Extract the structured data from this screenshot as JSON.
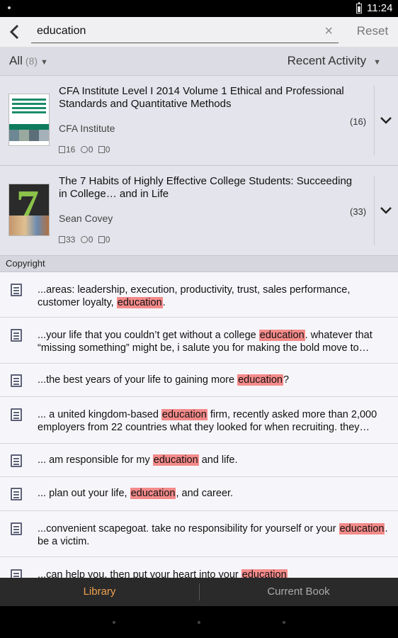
{
  "status_bar": {
    "time": "11:24"
  },
  "search": {
    "query": "education",
    "clear_icon": "×",
    "reset_label": "Reset"
  },
  "filter": {
    "label": "All",
    "count": "(8)",
    "sort_label": "Recent Activity"
  },
  "books": [
    {
      "title": "CFA Institute Level I 2014 Volume 1 Ethical and Professional Standards and Quantitative Methods",
      "author": "CFA Institute",
      "pages": "16",
      "notes": "0",
      "edits": "0",
      "count": "(16)"
    },
    {
      "title": "The 7 Habits of Highly Effective College Students: Succeeding in College… and in Life",
      "author": "Sean Covey",
      "pages": "33",
      "notes": "0",
      "edits": "0",
      "count": "(33)"
    }
  ],
  "section_label": "Copyright",
  "results": [
    {
      "before": "...areas: leadership, execution, productivity, trust, sales performance, customer loyalty, ",
      "match": "education",
      "after": "."
    },
    {
      "before": "...your life that you couldn’t get without a college ",
      "match": "education",
      "after": ". whatever that “missing something” might be, i salute you for making the bold move to…"
    },
    {
      "before": "...the best years of your life to gaining more ",
      "match": "education",
      "after": "?"
    },
    {
      "before": "... a united kingdom-based ",
      "match": "education",
      "after": " firm, recently asked more than 2,000 employers from 22 countries what they looked for when recruiting. they…"
    },
    {
      "before": "... am responsible for my ",
      "match": "education",
      "after": " and life."
    },
    {
      "before": "... plan out your life, ",
      "match": "education",
      "after": ", and career."
    },
    {
      "before": "...convenient scapegoat. take no responsibility for yourself or your ",
      "match": "education",
      "after": ". be a victim."
    },
    {
      "before": "...can help you, then put your heart into your ",
      "match": "education",
      "after": ""
    }
  ],
  "bottom_tabs": {
    "library": "Library",
    "current_book": "Current Book"
  },
  "colors": {
    "accent": "#f0a050",
    "highlight": "#f48a8a"
  }
}
